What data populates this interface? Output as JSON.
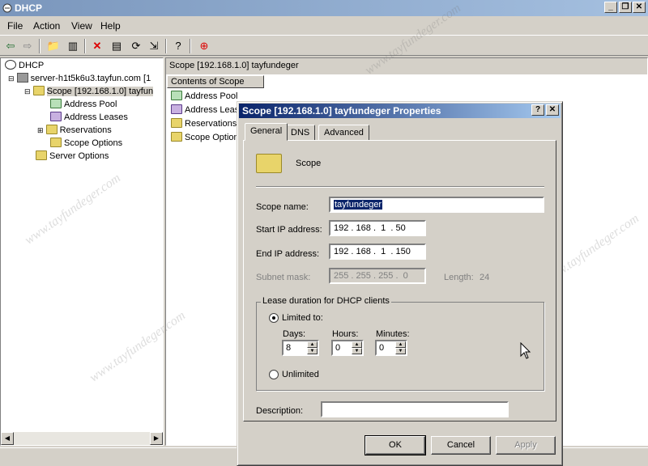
{
  "window": {
    "title": "DHCP"
  },
  "menu": [
    "File",
    "Action",
    "View",
    "Help"
  ],
  "tree": {
    "root": "DHCP",
    "server": "server-h1t5k6u3.tayfun.com [1",
    "scope": "Scope [192.168.1.0] tayfun",
    "children": [
      "Address Pool",
      "Address Leases",
      "Reservations",
      "Scope Options"
    ],
    "server_options": "Server Options"
  },
  "right": {
    "title": "Scope [192.168.1.0] tayfundeger",
    "column": "Contents of Scope",
    "items": [
      "Address Pool",
      "Address Leas",
      "Reservations",
      "Scope Option"
    ]
  },
  "dialog": {
    "title": "Scope [192.168.1.0] tayfundeger Properties",
    "tabs": [
      "General",
      "DNS",
      "Advanced"
    ],
    "header": "Scope",
    "scope_name_label": "Scope name:",
    "scope_name": "tayfundeger",
    "start_ip_label": "Start IP address:",
    "start_ip": [
      "192",
      "168",
      "1",
      "50"
    ],
    "end_ip_label": "End IP address:",
    "end_ip": [
      "192",
      "168",
      "1",
      "150"
    ],
    "subnet_label": "Subnet mask:",
    "subnet": [
      "255",
      "255",
      "255",
      "0"
    ],
    "length_label": "Length:",
    "length": "24",
    "lease_group": "Lease duration for DHCP clients",
    "limited_label": "Limited to:",
    "days_label": "Days:",
    "days": "8",
    "hours_label": "Hours:",
    "hours": "0",
    "minutes_label": "Minutes:",
    "minutes": "0",
    "unlimited_label": "Unlimited",
    "description_label": "Description:",
    "description": "",
    "ok": "OK",
    "cancel": "Cancel",
    "apply": "Apply"
  },
  "watermark": "www.tayfundeger.com",
  "icons": [
    "dhcp-icon",
    "server-icon",
    "folder-icon",
    "pool-icon",
    "leases-icon",
    "reservations-icon",
    "options-icon"
  ]
}
